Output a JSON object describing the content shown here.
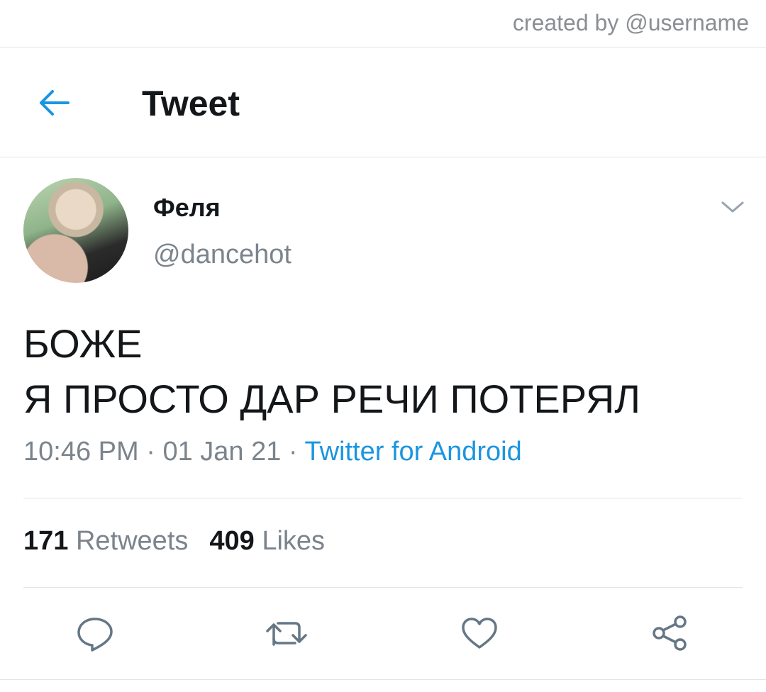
{
  "credit": "created by @username",
  "header": {
    "title": "Tweet",
    "back_icon": "arrow-left-icon"
  },
  "author": {
    "name": "Феля",
    "handle": "@dancehot",
    "menu_icon": "chevron-down-icon"
  },
  "tweet": {
    "lines": [
      "БОЖЕ",
      "Я ПРОСТО ДАР РЕЧИ ПОТЕРЯЛ"
    ],
    "time": "10:46 PM",
    "date": "01 Jan 21",
    "separator": " · ",
    "source": "Twitter for Android"
  },
  "stats": {
    "retweets_count": "171",
    "retweets_label": "Retweets",
    "likes_count": "409",
    "likes_label": "Likes"
  },
  "actions": [
    "reply-icon",
    "retweet-icon",
    "like-icon",
    "share-icon"
  ],
  "colors": {
    "accent": "#1b95e0",
    "muted": "#7b848c",
    "text": "#14171a",
    "divider": "#e1e5e8"
  }
}
